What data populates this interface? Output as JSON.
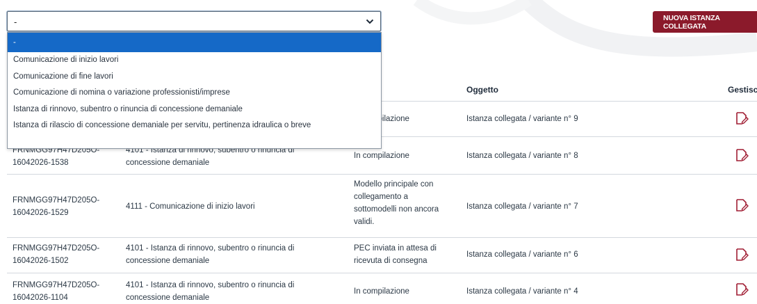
{
  "select": {
    "value": "-",
    "options": [
      "-",
      "Comunicazione di inizio lavori",
      "Comunicazione di fine lavori",
      "Comunicazione di nomina o variazione professionisti/imprese",
      "Istanza di rinnovo, subentro o rinuncia di concessione demaniale",
      "Istanza di rilascio di concessione demaniale per servitu, pertinenza idraulica o breve"
    ]
  },
  "toolbar": {
    "new_button_label": "NUOVA ISTANZA COLLEGATA"
  },
  "table": {
    "headers": {
      "oggetto": "Oggetto",
      "gestisci": "Gestisci"
    },
    "rows": [
      {
        "code1": "",
        "code2": "",
        "desc1": "",
        "desc2": "",
        "stato1": "In compilazione",
        "stato2": "",
        "stato3": "",
        "stato4": "",
        "oggetto": "Istanza collegata / variante n° 9"
      },
      {
        "code1": "FRNMGG97H47D205O-",
        "code2": "16042026-1538",
        "desc1": "4101 - Istanza di rinnovo, subentro o rinuncia di",
        "desc2": "concessione demaniale",
        "stato1": "In compilazione",
        "stato2": "",
        "stato3": "",
        "stato4": "",
        "oggetto": "Istanza collegata / variante n° 8"
      },
      {
        "code1": "FRNMGG97H47D205O-",
        "code2": "16042026-1529",
        "desc1": "4111 - Comunicazione di inizio lavori",
        "desc2": "",
        "stato1": "Modello principale con",
        "stato2": "collegamento a",
        "stato3": "sottomodelli non ancora",
        "stato4": "validi.",
        "oggetto": "Istanza collegata / variante n° 7"
      },
      {
        "code1": "FRNMGG97H47D205O-",
        "code2": "16042026-1502",
        "desc1": "4101 - Istanza di rinnovo, subentro o rinuncia di",
        "desc2": "concessione demaniale",
        "stato1": "PEC inviata in attesa di",
        "stato2": "ricevuta di consegna",
        "stato3": "",
        "stato4": "",
        "oggetto": "Istanza collegata / variante n° 6"
      },
      {
        "code1": "FRNMGG97H47D205O-",
        "code2": "16042026-1104",
        "desc1": "4101 - Istanza di rinnovo, subentro o rinuncia di",
        "desc2": "concessione demaniale",
        "stato1": "In compilazione",
        "stato2": "",
        "stato3": "",
        "stato4": "",
        "oggetto": "Istanza collegata / variante n° 4"
      }
    ]
  },
  "colors": {
    "accent": "#8b1a2b",
    "selected_option": "#1569c7",
    "edit_icon": "#a01d33"
  }
}
